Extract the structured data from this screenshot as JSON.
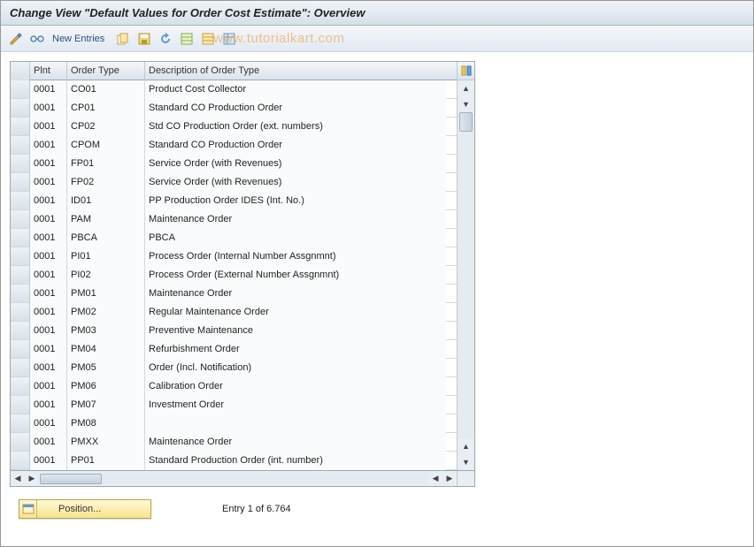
{
  "title": "Change View \"Default Values for Order Cost Estimate\": Overview",
  "toolbar": {
    "new_entries_label": "New Entries"
  },
  "watermark": "www.tutorialkart.com",
  "table": {
    "headers": {
      "plnt": "Plnt",
      "order_type": "Order Type",
      "description": "Description of Order Type"
    },
    "rows": [
      {
        "plnt": "0001",
        "otype": "CO01",
        "desc": "Product Cost Collector"
      },
      {
        "plnt": "0001",
        "otype": "CP01",
        "desc": "Standard CO Production Order"
      },
      {
        "plnt": "0001",
        "otype": "CP02",
        "desc": "Std CO Production Order (ext. numbers)"
      },
      {
        "plnt": "0001",
        "otype": "CPOM",
        "desc": "Standard CO Production Order"
      },
      {
        "plnt": "0001",
        "otype": "FP01",
        "desc": "Service Order (with Revenues)"
      },
      {
        "plnt": "0001",
        "otype": "FP02",
        "desc": "Service Order (with Revenues)"
      },
      {
        "plnt": "0001",
        "otype": "ID01",
        "desc": "PP Production Order IDES      (Int. No.)"
      },
      {
        "plnt": "0001",
        "otype": "PAM",
        "desc": "Maintenance Order"
      },
      {
        "plnt": "0001",
        "otype": "PBCA",
        "desc": "PBCA"
      },
      {
        "plnt": "0001",
        "otype": "PI01",
        "desc": "Process Order (Internal Number Assgnmnt)"
      },
      {
        "plnt": "0001",
        "otype": "PI02",
        "desc": "Process Order (External Number Assgnmnt)"
      },
      {
        "plnt": "0001",
        "otype": "PM01",
        "desc": "Maintenance Order"
      },
      {
        "plnt": "0001",
        "otype": "PM02",
        "desc": "Regular Maintenance Order"
      },
      {
        "plnt": "0001",
        "otype": "PM03",
        "desc": "Preventive Maintenance"
      },
      {
        "plnt": "0001",
        "otype": "PM04",
        "desc": "Refurbishment Order"
      },
      {
        "plnt": "0001",
        "otype": "PM05",
        "desc": "Order (Incl. Notification)"
      },
      {
        "plnt": "0001",
        "otype": "PM06",
        "desc": "Calibration Order"
      },
      {
        "plnt": "0001",
        "otype": "PM07",
        "desc": "Investment Order"
      },
      {
        "plnt": "0001",
        "otype": "PM08",
        "desc": ""
      },
      {
        "plnt": "0001",
        "otype": "PMXX",
        "desc": "Maintenance Order"
      },
      {
        "plnt": "0001",
        "otype": "PP01",
        "desc": "Standard Production Order (int. number)"
      }
    ]
  },
  "footer": {
    "position_label": "Position...",
    "entry_text": "Entry 1 of 6.764"
  }
}
